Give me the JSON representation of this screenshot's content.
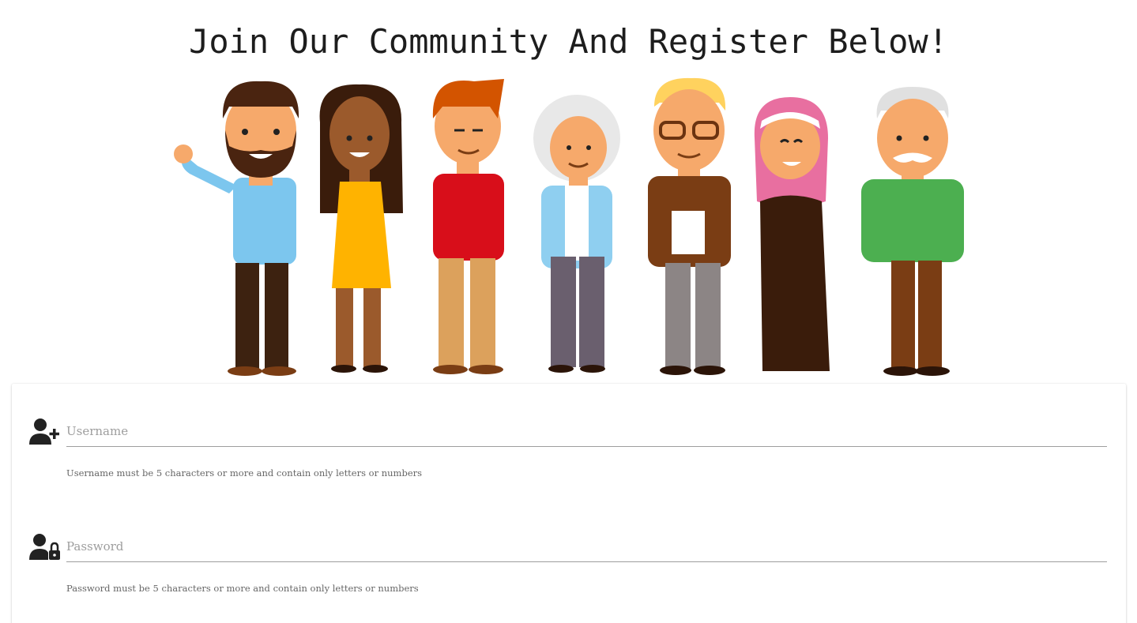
{
  "page": {
    "title": "Join Our Community And Register Below!"
  },
  "illustration": {
    "icon": "diverse-people-group-illustration"
  },
  "form": {
    "username": {
      "placeholder": "Username",
      "value": "",
      "helper": "Username must be 5 characters or more and contain only letters or numbers",
      "icon": "user-plus-icon"
    },
    "password": {
      "placeholder": "Password",
      "value": "",
      "helper": "Password must be 5 characters or more and contain only letters or numbers",
      "icon": "user-lock-icon"
    }
  },
  "colors": {
    "text": "#1d1d1d",
    "input_underline": "#9e9e9e",
    "helper_text": "#666666"
  }
}
